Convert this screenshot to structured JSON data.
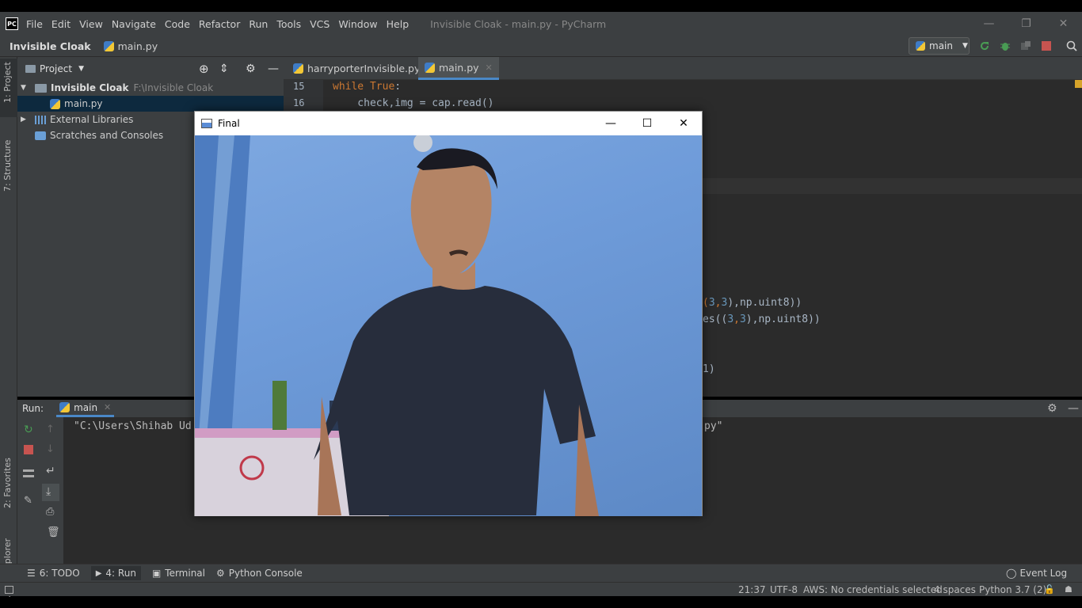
{
  "window_title": "Invisible Cloak - main.py - PyCharm",
  "menu": [
    "File",
    "Edit",
    "View",
    "Navigate",
    "Code",
    "Refactor",
    "Run",
    "Tools",
    "VCS",
    "Window",
    "Help"
  ],
  "navbar": {
    "project": "Invisible Cloak",
    "file": "main.py",
    "run_config": "main"
  },
  "left_tools": {
    "project_tab": "1: Project",
    "structure_tab": "7: Structure",
    "favorites_tab": "2: Favorites",
    "aws_tab": "AWS Explorer"
  },
  "project_panel": {
    "title": "Project",
    "tree": [
      {
        "label": "Invisible Cloak",
        "path": "F:\\Invisible Cloak"
      },
      {
        "label": "main.py"
      },
      {
        "label": "External Libraries"
      },
      {
        "label": "Scratches and Consoles"
      }
    ]
  },
  "editor_tabs": [
    "harryporterInvisible.py",
    "main.py"
  ],
  "editor": {
    "line_numbers": [
      "15",
      "16"
    ],
    "line15_kw": "while True",
    "line15_rest": ":",
    "line16": "    check,img = cap.read()",
    "frag1_a": "(",
    "frag1_n1": "3",
    "frag1_c": ",",
    "frag1_n2": "3",
    "frag1_b": "),np.uint8))",
    "frag2_a": "es((",
    "frag2_n1": "3",
    "frag2_c": ",",
    "frag2_n2": "3",
    "frag2_b": "),np.uint8))",
    "frag3": "1)"
  },
  "run_panel": {
    "label": "Run:",
    "tab": "main",
    "console_line": "\"C:\\Users\\Shihab Ud",
    "console_tail": "py\""
  },
  "bottom_tools": [
    "6: TODO",
    "4: Run",
    "Terminal",
    "Python Console"
  ],
  "event_log": "Event Log",
  "status": {
    "position": "21:37",
    "encoding": "UTF-8",
    "aws": "AWS: No credentials selected",
    "indent": "4 spaces",
    "interpreter": "Python 3.7 (2)"
  },
  "final_window": {
    "title": "Final"
  },
  "colors": {
    "accent": "#4a88c7",
    "keyword": "#cc7832",
    "number": "#6897bb",
    "stop_red": "#c75450",
    "run_green": "#499c54"
  }
}
